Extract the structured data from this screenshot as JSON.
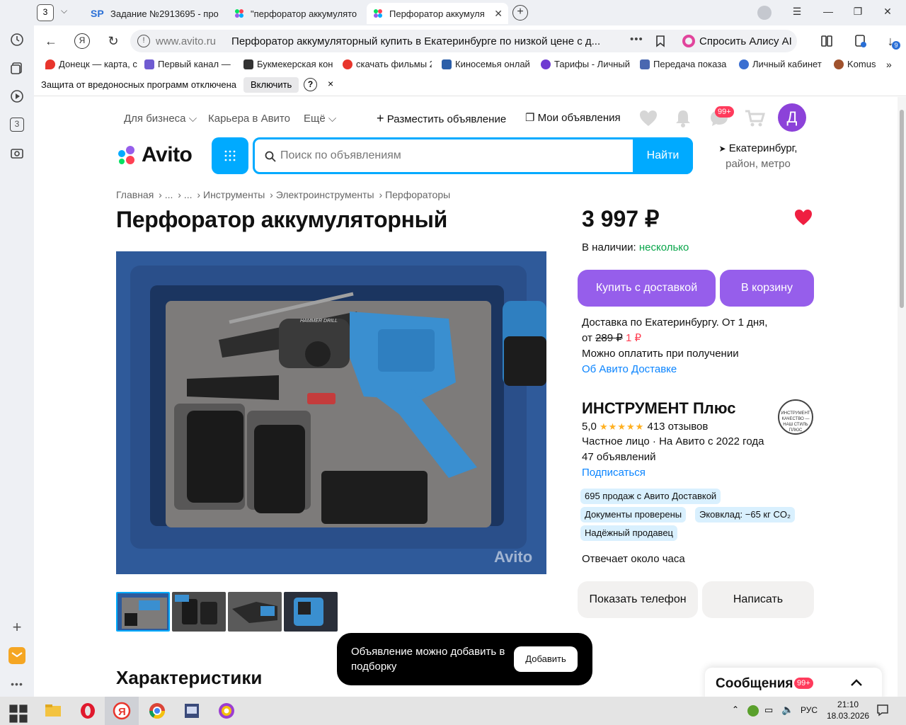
{
  "browser": {
    "tab_counter": "3",
    "tabs": [
      {
        "title": "Задание №2913695 - про"
      },
      {
        "title": "\"перфоратор аккумулято"
      },
      {
        "title": "Перфоратор аккумуля"
      }
    ],
    "address_host": "www.avito.ru",
    "address_title": "Перфоратор аккумуляторный купить в Екатеринбурге по низкой цене с д...",
    "alice_label": "Спросить Алису AI",
    "downloads_badge": "9",
    "sidebar_badge": "3",
    "bookmarks": [
      {
        "label": "Донецк — карта, с",
        "color": "#e8352c"
      },
      {
        "label": "Первый канал — с",
        "color": "#6f5bd1"
      },
      {
        "label": "Букмекерская кон",
        "color": "#333333"
      },
      {
        "label": "скачать фильмы 2",
        "color": "#e8352c"
      },
      {
        "label": "Киносемья онлай",
        "color": "#2b5ea8"
      },
      {
        "label": "Тарифы - Личный",
        "color": "#6f3bd1"
      },
      {
        "label": "Передача показа",
        "color": "#4a67b0"
      },
      {
        "label": "Личный кабинет",
        "color": "#3b6fd1"
      },
      {
        "label": "Komus",
        "color": "#a0522d"
      }
    ],
    "infobar": {
      "message": "Защита от вредоносных программ отключена",
      "enable_label": "Включить",
      "help": "?",
      "close": "×"
    }
  },
  "header": {
    "business": "Для бизнеса",
    "career": "Карьера в Авито",
    "more": "Ещё",
    "post_ad": "Разместить объявление",
    "my_ads": "Мои объявления",
    "messages_badge": "99+",
    "avatar_letter": "Д",
    "logo_text": "Avito",
    "search_placeholder": "Поиск по объявлениям",
    "search_button": "Найти",
    "location_city": "Екатеринбург,",
    "location_sub": "район, метро"
  },
  "breadcrumbs": [
    "Главная",
    "...",
    "...",
    "Инструменты",
    "Электроинструменты",
    "Перфораторы"
  ],
  "listing": {
    "title": "Перфоратор аккумуляторный",
    "price": "3 997 ₽",
    "stock_label": "В наличии:",
    "stock_value": "несколько",
    "buy_delivery": "Купить с доставкой",
    "to_cart": "В корзину",
    "delivery_line1": "Доставка по Екатеринбургу. От 1 дня,",
    "delivery_from": "от",
    "delivery_old_price": "289 ₽",
    "delivery_new_price": "1 ₽",
    "pay_on_receipt": "Можно оплатить при получении",
    "about_delivery": "Об Авито Доставке",
    "image_watermark": "Avito",
    "image_brand": "HAMMER DRILL",
    "characteristics_title": "Характеристики"
  },
  "seller": {
    "name": "ИНСТРУМЕНТ Плюс",
    "rating": "5,0",
    "stars": "★★★★★",
    "reviews": "413 отзывов",
    "type": "Частное лицо · На Авито с 2022 года",
    "ads_count": "47 объявлений",
    "subscribe": "Подписаться",
    "logo_text": "ИНСТРУМЕНТ КАЧЕСТВО — НАШ СТИЛЬ ПЛЮС",
    "chips": [
      "695 продаж с Авито Доставкой",
      "Документы проверены",
      "Эковклад: −65 кг CO₂",
      "Надёжный продавец"
    ],
    "reply_time": "Отвечает около часа",
    "show_phone": "Показать телефон",
    "write": "Написать"
  },
  "toast": {
    "text": "Объявление можно добавить в подборку",
    "button": "Добавить"
  },
  "messages_panel": {
    "label": "Сообщения",
    "badge": "99+"
  },
  "taskbar": {
    "lang": "РУС",
    "time": "21:10",
    "date": "18.03.2026"
  }
}
